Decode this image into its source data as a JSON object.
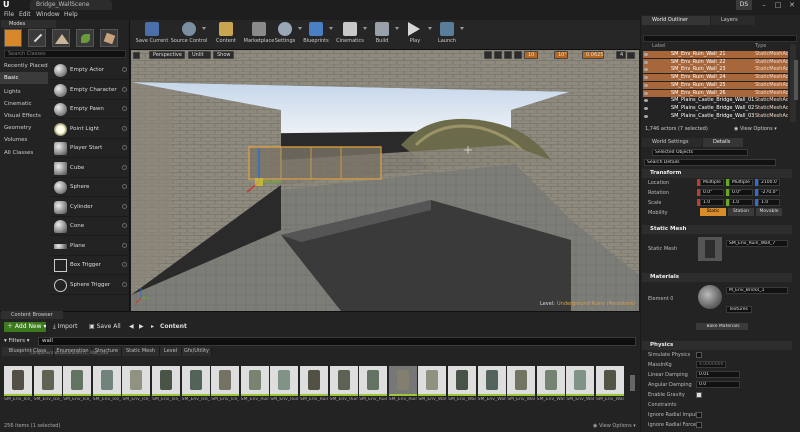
{
  "window": {
    "title": "Bridge_WallScene",
    "user": "DS",
    "controls": [
      "–",
      "□",
      "✕"
    ]
  },
  "menu": [
    "File",
    "Edit",
    "Window",
    "Help"
  ],
  "modes": {
    "tab_label": "Modes",
    "search_placeholder": "Search Classes",
    "categories": [
      "Recently Placed",
      "Basic",
      "Lights",
      "Cinematic",
      "Visual Effects",
      "Geometry",
      "Volumes",
      "All Classes"
    ],
    "actors": [
      "Empty Actor",
      "Empty Character",
      "Empty Pawn",
      "Point Light",
      "Player Start",
      "Cube",
      "Sphere",
      "Cylinder",
      "Cone",
      "Plane",
      "Box Trigger",
      "Sphere Trigger"
    ]
  },
  "toolbar": {
    "buttons": [
      "Save Current",
      "Source Control",
      "Content",
      "Marketplace",
      "Settings",
      "Blueprints",
      "Cinematics",
      "Build",
      "Play",
      "Launch"
    ]
  },
  "viewport": {
    "perspective": "Perspective",
    "lit": "Unlit",
    "show": "Show",
    "grid": "10",
    "angle": "10°",
    "scale": "0.0625",
    "cams": "4",
    "level_label": "Level:",
    "level_name": "Underground Ruins (Persistent)"
  },
  "content_browser": {
    "tab_label": "Content Browser",
    "add_new": "Add New",
    "import": "Import",
    "save_all": "Save All",
    "path": "Content",
    "filters": "Filters",
    "search_value": "wall",
    "filter_tabs": [
      "Blueprint Class",
      "Enumeration",
      "Structure",
      "Static Mesh",
      "Level",
      "Gfx/Utility"
    ],
    "header_labels": [
      "Component w/...",
      "Decorative (l...",
      "Wall_03a"
    ],
    "assets": [
      {
        "label": "SM_Env_Ice_Cliffs_Cliff"
      },
      {
        "label": "SM_Env_Ice_Cliffs_Cliff"
      },
      {
        "label": "SM_Env_Ice_Cliffs_Cliff"
      },
      {
        "label": "SM_Env_Ice_Cliffs_Cliff"
      },
      {
        "label": "SM_Env_Ice_Cliffs_Cliff"
      },
      {
        "label": "SM_Env_Ice_Cliffs_Cliff"
      },
      {
        "label": "SM_Env_Ice_Cliffs_Cliff"
      },
      {
        "label": "SM_Env_Ice_Cliffs_Cliff"
      },
      {
        "label": "SM_Env_Ruined_Walls_001"
      },
      {
        "label": "SM_Env_Ruined_Walls_001"
      },
      {
        "label": "SM_Env_Ruined_Walls_002"
      },
      {
        "label": "SM_Env_Ruined_Walls_003"
      },
      {
        "label": "SM_Env_Ruin_Wall_1"
      },
      {
        "label": "SM_Env_Ruin_Wall"
      },
      {
        "label": "SM_Env_Wall_Corner_001"
      },
      {
        "label": "SM_Env_Wall_Corner_002"
      },
      {
        "label": "SM_Env_Wall_Corner_003"
      },
      {
        "label": "SM_Env_Wall_Corner_004"
      },
      {
        "label": "SM_Env_Wall_Normal_1"
      },
      {
        "label": "SM_Env_Wall_Normal_1"
      },
      {
        "label": "SM_Env_Wall_Normal_1"
      }
    ],
    "status": "256 items (1 selected)",
    "view_options": "View Options"
  },
  "outliner": {
    "tabs": [
      "World Outliner",
      "Layers"
    ],
    "columns": [
      "Label",
      "Type"
    ],
    "rows": [
      {
        "label": "SM_Env_Ruin_Wall_21",
        "type": "StaticMeshActor",
        "sel": true
      },
      {
        "label": "SM_Env_Ruin_Wall_22",
        "type": "StaticMeshActor",
        "sel": true
      },
      {
        "label": "SM_Env_Ruin_Wall_23",
        "type": "StaticMeshActor",
        "sel": true
      },
      {
        "label": "SM_Env_Ruin_Wall_24",
        "type": "StaticMeshActor",
        "sel": true
      },
      {
        "label": "SM_Env_Ruin_Wall_25",
        "type": "StaticMeshActor",
        "sel": true
      },
      {
        "label": "SM_Env_Ruin_Wall_26",
        "type": "StaticMeshActor",
        "sel": true
      },
      {
        "label": "SM_Plains_Castle_Bridge_Wall_01",
        "type": "StaticMeshActor",
        "sel": false
      },
      {
        "label": "SM_Plains_Castle_Bridge_Wall_02",
        "type": "StaticMeshActor",
        "sel": false
      },
      {
        "label": "SM_Plains_Castle_Bridge_Wall_03",
        "type": "StaticMeshActor",
        "sel": false
      }
    ],
    "status": "1,746 actors (7 selected)",
    "view_options": "View Options"
  },
  "details": {
    "tabs": [
      "World Settings",
      "Details"
    ],
    "object_name": "Selected Objects",
    "search_placeholder": "Search Details",
    "transform": {
      "title": "Transform",
      "location": {
        "label": "Location",
        "x": "Multiple",
        "y": "Multiple",
        "z": "2100.0"
      },
      "rotation": {
        "label": "Rotation",
        "x": "0.0°",
        "y": "0.0°",
        "z": "-270.0°"
      },
      "scale": {
        "label": "Scale",
        "x": "1.0",
        "y": "1.0",
        "z": "1.0"
      },
      "mobility": {
        "label": "Mobility",
        "options": [
          "Static",
          "Station",
          "Movable"
        ]
      }
    },
    "static_mesh": {
      "title": "Static Mesh",
      "label": "Static Mesh",
      "value": "SM_Env_Ruin_Wall_7"
    },
    "materials": {
      "title": "Materials",
      "label": "Element 0",
      "value": "M_Env_Bricks_1",
      "sub": "Textures",
      "bake": "Bake Materials"
    },
    "physics": {
      "title": "Physics",
      "simulate": "Simulate Physics",
      "mass_label": "MassInKg",
      "mass_value": "4.0000000",
      "linear": "Linear Damping",
      "linear_value": "0.01",
      "angular": "Angular Damping",
      "angular_value": "0.0",
      "gravity": "Enable Gravity",
      "constraints": "Constraints",
      "impulse": "Ignore Radial Impulse",
      "force": "Ignore Radial Force"
    }
  },
  "colors": {
    "accent_orange": "#a8663b",
    "add_green": "#3c7a1e",
    "asset_bar": "#9fc53a",
    "axis_x": "#c43a2e",
    "axis_y": "#6aa82b",
    "axis_z": "#2d6fd0"
  }
}
